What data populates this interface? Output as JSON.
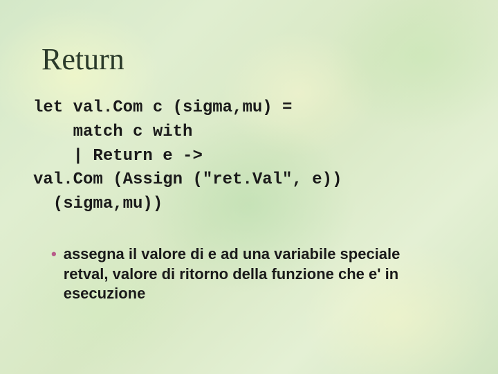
{
  "title": "Return",
  "code_lines": [
    "let val.Com c (sigma,mu) =",
    "    match c with",
    "    | Return e ->",
    "val.Com (Assign (\"ret.Val\", e))",
    "  (sigma,mu))"
  ],
  "bullet": {
    "marker": "•",
    "text": "assegna il valore di e ad una variabile speciale retval, valore di ritorno della funzione che e' in esecuzione"
  }
}
